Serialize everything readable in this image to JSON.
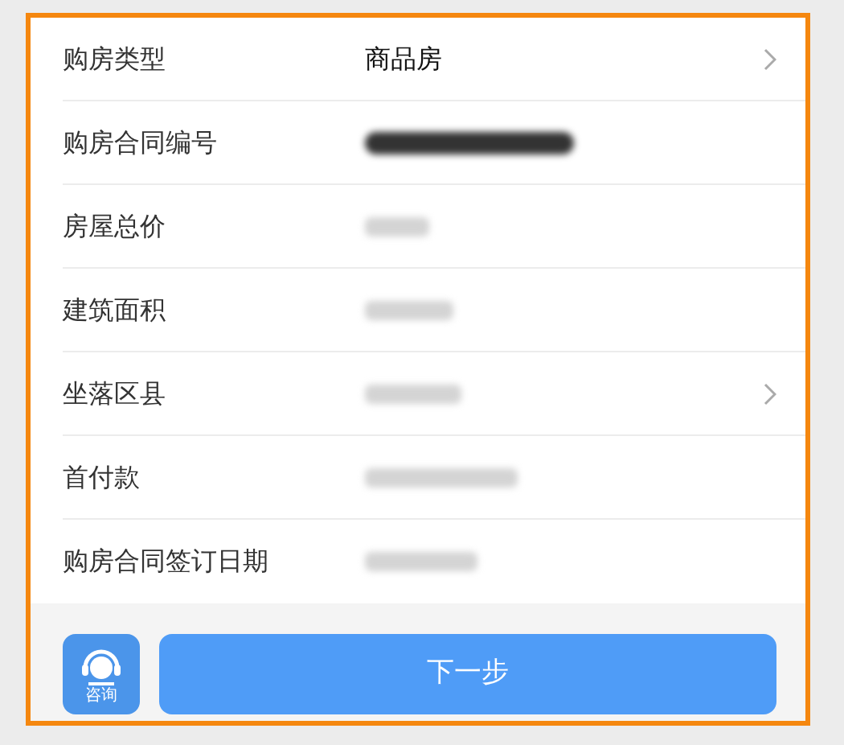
{
  "rows": [
    {
      "label": "购房类型",
      "kind": "text",
      "value": "商品房",
      "chevron": true
    },
    {
      "label": "购房合同编号",
      "kind": "redacted",
      "chevron": false
    },
    {
      "label": "房屋总价",
      "kind": "blurred",
      "chevron": false
    },
    {
      "label": "建筑面积",
      "kind": "blurred",
      "chevron": false
    },
    {
      "label": "坐落区县",
      "kind": "blurred",
      "chevron": true
    },
    {
      "label": "首付款",
      "kind": "blurred",
      "chevron": false
    },
    {
      "label": "购房合同签订日期",
      "kind": "blurred",
      "chevron": false
    }
  ],
  "consult": {
    "label": "咨询"
  },
  "next_button": {
    "label": "下一步"
  }
}
